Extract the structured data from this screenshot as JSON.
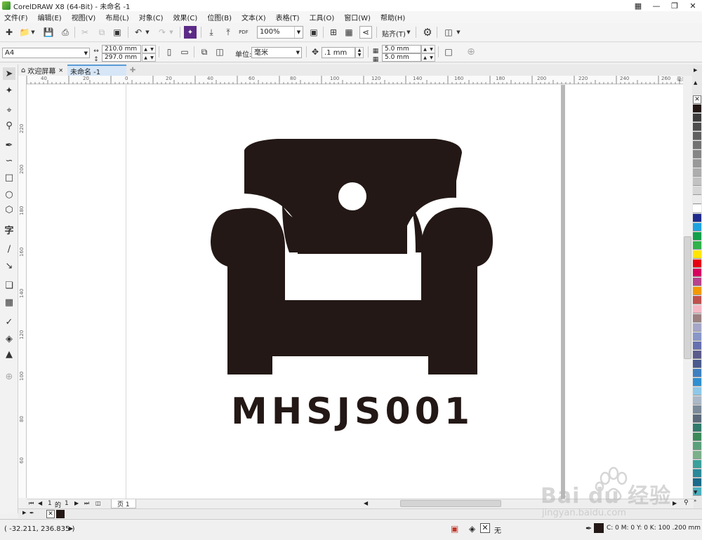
{
  "window": {
    "title": "CorelDRAW X8 (64-Bit) - 未命名 -1"
  },
  "menu": [
    "文件(F)",
    "编辑(E)",
    "视图(V)",
    "布局(L)",
    "对象(C)",
    "效果(C)",
    "位图(B)",
    "文本(X)",
    "表格(T)",
    "工具(O)",
    "窗口(W)",
    "帮助(H)"
  ],
  "toolbar": {
    "zoom": "100%",
    "snap_label": "贴齐(T)",
    "pdf_label": "PDF"
  },
  "propbar": {
    "page_size": "A4",
    "width": "210.0 mm",
    "height": "297.0 mm",
    "units_label": "单位:",
    "units_value": "毫米",
    "nudge": ".1 mm",
    "dup_x": "5.0 mm",
    "dup_y": "5.0 mm"
  },
  "tabs": {
    "home": "欢迎屏幕",
    "doc": "未命名 -1"
  },
  "rulers": {
    "h_ticks": [
      "40",
      "20",
      "0",
      "20",
      "40",
      "60",
      "80",
      "100",
      "120",
      "140",
      "160",
      "180",
      "200",
      "220",
      "240",
      "260"
    ],
    "h_unit": "毫米",
    "v_ticks": [
      "220",
      "200",
      "180",
      "160",
      "140",
      "120",
      "100",
      "80",
      "60"
    ]
  },
  "artwork": {
    "logo_text": "MHSJS001",
    "fill_color": "#231815"
  },
  "pagenav": {
    "current": "1",
    "of_label": "的",
    "total": "1",
    "page_tab": "页 1"
  },
  "status": {
    "coords": "( -32.211, 236.835 )",
    "fill_none": "无",
    "outline_info": "C: 0 M: 0 Y: 0 K: 100  .200 mm"
  },
  "palette": [
    "#ffffff",
    "#231815",
    "#3c3c3c",
    "#4d4d4d",
    "#606060",
    "#727272",
    "#858585",
    "#999999",
    "#adadad",
    "#c2c2c2",
    "#d6d6d6",
    "#ebebeb",
    "#ffffff",
    "#1e2b8c",
    "#1fa3e0",
    "#13a04a",
    "#2fb34a",
    "#ffe500",
    "#e60012",
    "#d7005f",
    "#b8418e",
    "#f39800",
    "#c0504d",
    "#f5b8c4",
    "#9c8080",
    "#a6a6c8",
    "#8896c8",
    "#6670b0",
    "#5b5b8c",
    "#4a5a8c",
    "#3d7fc0",
    "#2f8fd0",
    "#8fc8e8",
    "#aab8c8",
    "#7a8a9a",
    "#5a6a7a",
    "#2f7a6a",
    "#3a8a5a",
    "#5aa07a",
    "#7ab08a",
    "#3aa09a",
    "#2a8a9a",
    "#1a6a8a",
    "#4ab0c0"
  ],
  "watermark": {
    "brand": "Bai du 经验",
    "url": "jingyan.baidu.com"
  }
}
